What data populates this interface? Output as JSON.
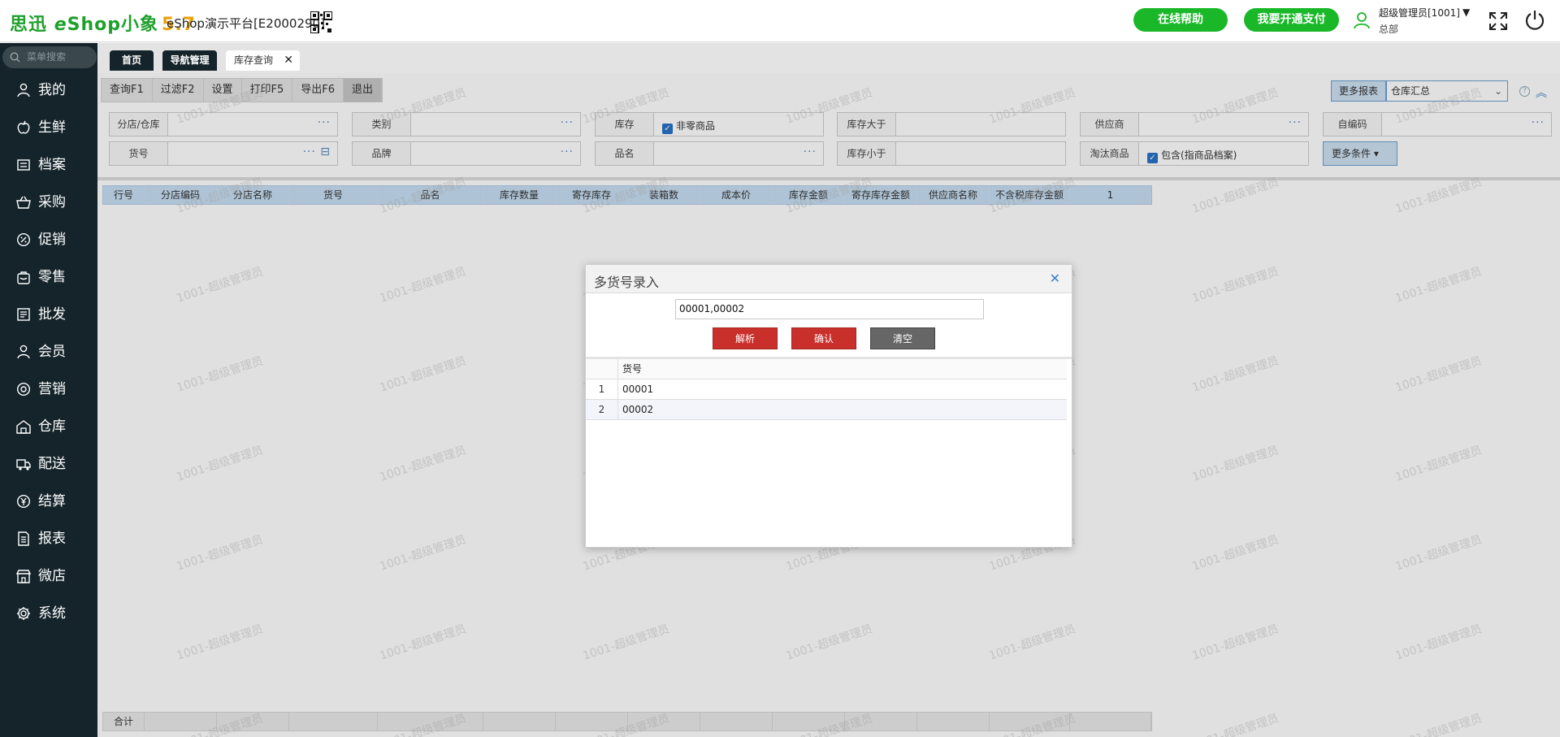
{
  "header": {
    "logo_brand": "思迅",
    "logo_e": "e",
    "logo_shop": "Shop小象",
    "logo_version": "5.7",
    "platform": "eShop演示平台[E2000290]",
    "help_button": "在线帮助",
    "pay_button": "我要开通支付",
    "user_name": "超级管理员[1001]",
    "user_org": "总部",
    "user_caret": "▼"
  },
  "sidebar": {
    "search_placeholder": "菜单搜索",
    "items": [
      {
        "label": "我的",
        "icon": "user-icon"
      },
      {
        "label": "生鲜",
        "icon": "apple-icon"
      },
      {
        "label": "档案",
        "icon": "folder-icon"
      },
      {
        "label": "采购",
        "icon": "basket-icon"
      },
      {
        "label": "促销",
        "icon": "discount-icon"
      },
      {
        "label": "零售",
        "icon": "bag-icon"
      },
      {
        "label": "批发",
        "icon": "list-icon"
      },
      {
        "label": "会员",
        "icon": "member-icon"
      },
      {
        "label": "营销",
        "icon": "marketing-icon"
      },
      {
        "label": "仓库",
        "icon": "warehouse-icon"
      },
      {
        "label": "配送",
        "icon": "truck-icon"
      },
      {
        "label": "结算",
        "icon": "yen-icon"
      },
      {
        "label": "报表",
        "icon": "report-icon"
      },
      {
        "label": "微店",
        "icon": "shop-icon"
      },
      {
        "label": "系统",
        "icon": "gear-icon"
      }
    ]
  },
  "tabs": [
    {
      "label": "首页",
      "style": "dark"
    },
    {
      "label": "导航管理",
      "style": "dark"
    },
    {
      "label": "库存查询",
      "style": "active",
      "close": "✕"
    }
  ],
  "toolbar": {
    "buttons": [
      "查询F1",
      "过滤F2",
      "设置",
      "打印F5",
      "导出F6",
      "退出"
    ],
    "more_report_label": "更多报表",
    "more_report_value": "仓库汇总"
  },
  "filters": {
    "branch": "分店/仓库",
    "category": "类别",
    "stock": "库存",
    "stock_check": "非零商品",
    "stock_gt": "库存大于",
    "supplier": "供应商",
    "self_code": "自编码",
    "item_no": "货号",
    "brand": "品牌",
    "item_name": "品名",
    "stock_lt": "库存小于",
    "discontinued": "淘汰商品",
    "discontinued_check": "包含(指商品档案)",
    "more_conditions": "更多条件"
  },
  "grid": {
    "columns": [
      "行号",
      "分店编码",
      "分店名称",
      "货号",
      "品名",
      "库存数量",
      "寄存库存",
      "装箱数",
      "成本价",
      "库存金额",
      "寄存库存金额",
      "供应商名称",
      "不含税库存金额",
      "1"
    ],
    "footer_label": "合计"
  },
  "watermark": "1001-超级管理员",
  "dialog": {
    "title": "多货号录入",
    "close": "✕",
    "input_value": "00001,00002",
    "parse_button": "解析",
    "confirm_button": "确认",
    "clear_button": "清空",
    "column": "货号",
    "rows": [
      {
        "num": "1",
        "item": "00001"
      },
      {
        "num": "2",
        "item": "00002"
      }
    ]
  },
  "colors": {
    "brand_green": "#1ab829",
    "sidebar_bg": "#15242b",
    "danger_red": "#c9302c",
    "header_blue": "#c7dff3"
  }
}
